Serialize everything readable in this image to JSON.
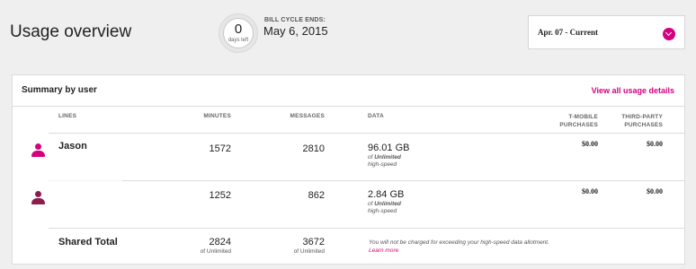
{
  "header": {
    "title": "Usage overview",
    "days_left_value": "0",
    "days_left_label": "days left",
    "bill_cycle_label": "BILL CYCLE ENDS:",
    "bill_cycle_date": "May 6, 2015",
    "period_selected": "Apr. 07 - Current"
  },
  "summary": {
    "title": "Summary by user",
    "view_all": "View all usage details",
    "columns": {
      "lines": "LINES",
      "minutes": "MINUTES",
      "messages": "MESSAGES",
      "data": "DATA",
      "tmobile_1": "T-MOBILE",
      "tmobile_2": "PURCHASES",
      "third_1": "THIRD-PARTY",
      "third_2": "PURCHASES"
    },
    "rows": [
      {
        "name": "Jason",
        "minutes": "1572",
        "messages": "2810",
        "data": "96.01 GB",
        "data_of": "of",
        "data_limit": "Unlimited",
        "data_speed": "high-speed",
        "tmobile": "$0.00",
        "third_party": "$0.00",
        "avatar_color": "#d6007e"
      },
      {
        "name": "",
        "minutes": "1252",
        "messages": "862",
        "data": "2.84 GB",
        "data_of": "of",
        "data_limit": "Unlimited",
        "data_speed": "high-speed",
        "tmobile": "$0.00",
        "third_party": "$0.00",
        "avatar_color": "#8e1d4e"
      }
    ],
    "total": {
      "label": "Shared Total",
      "minutes": "2824",
      "minutes_sub": "of Unlimited",
      "messages": "3672",
      "messages_sub": "of Unlimited",
      "note": "You will not be charged for exceeding your high-speed data allotment.",
      "learn_more": "Learn more"
    }
  },
  "colors": {
    "accent": "#d6007e",
    "avatar_dark": "#8e1d4e",
    "background": "#efefef"
  }
}
